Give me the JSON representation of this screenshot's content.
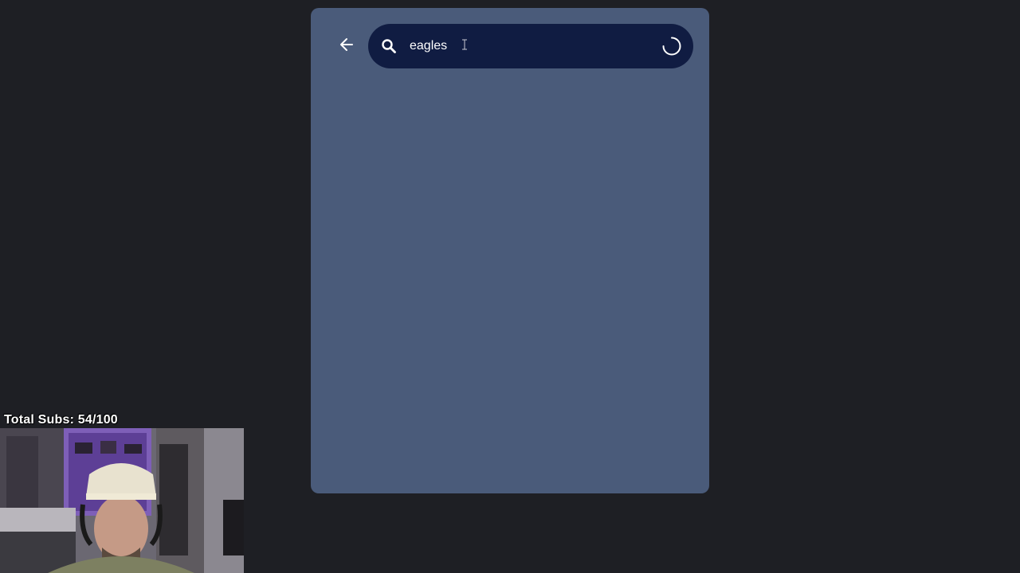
{
  "search": {
    "value": "eagles",
    "back_icon": "arrow-left-icon",
    "search_icon": "search-icon",
    "loading_icon": "loading-spinner-icon"
  },
  "stream_overlay": {
    "subs_label": "Total Subs: 54/100"
  },
  "colors": {
    "page_background": "#1e1f24",
    "panel_background": "#4a5b7a",
    "search_bar_background": "#101c42",
    "text": "#ffffff"
  }
}
